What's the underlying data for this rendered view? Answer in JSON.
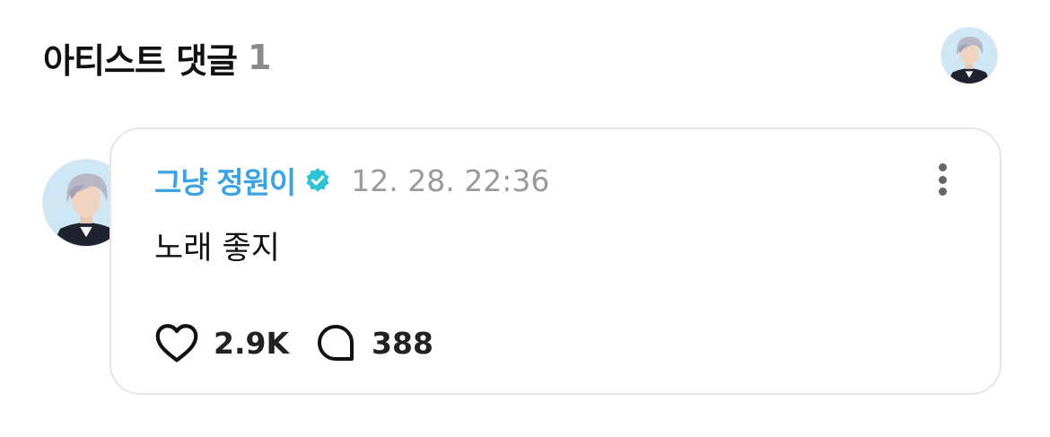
{
  "section": {
    "title": "아티스트 댓글",
    "count": "1"
  },
  "comment": {
    "author": "그냥 정원이",
    "verified": true,
    "timestamp": "12. 28. 22:36",
    "text": "노래 좋지",
    "likes": "2.9K",
    "replies": "388"
  },
  "colors": {
    "author_name": "#3aa3e6",
    "verified_badge": "#2ec4d6",
    "timestamp": "#9a9a9a",
    "card_border": "#e6e6e6"
  },
  "icons": {
    "like": "heart-icon",
    "reply": "speech-bubble-icon",
    "more": "more-vertical-icon",
    "verified": "verified-badge-icon"
  }
}
